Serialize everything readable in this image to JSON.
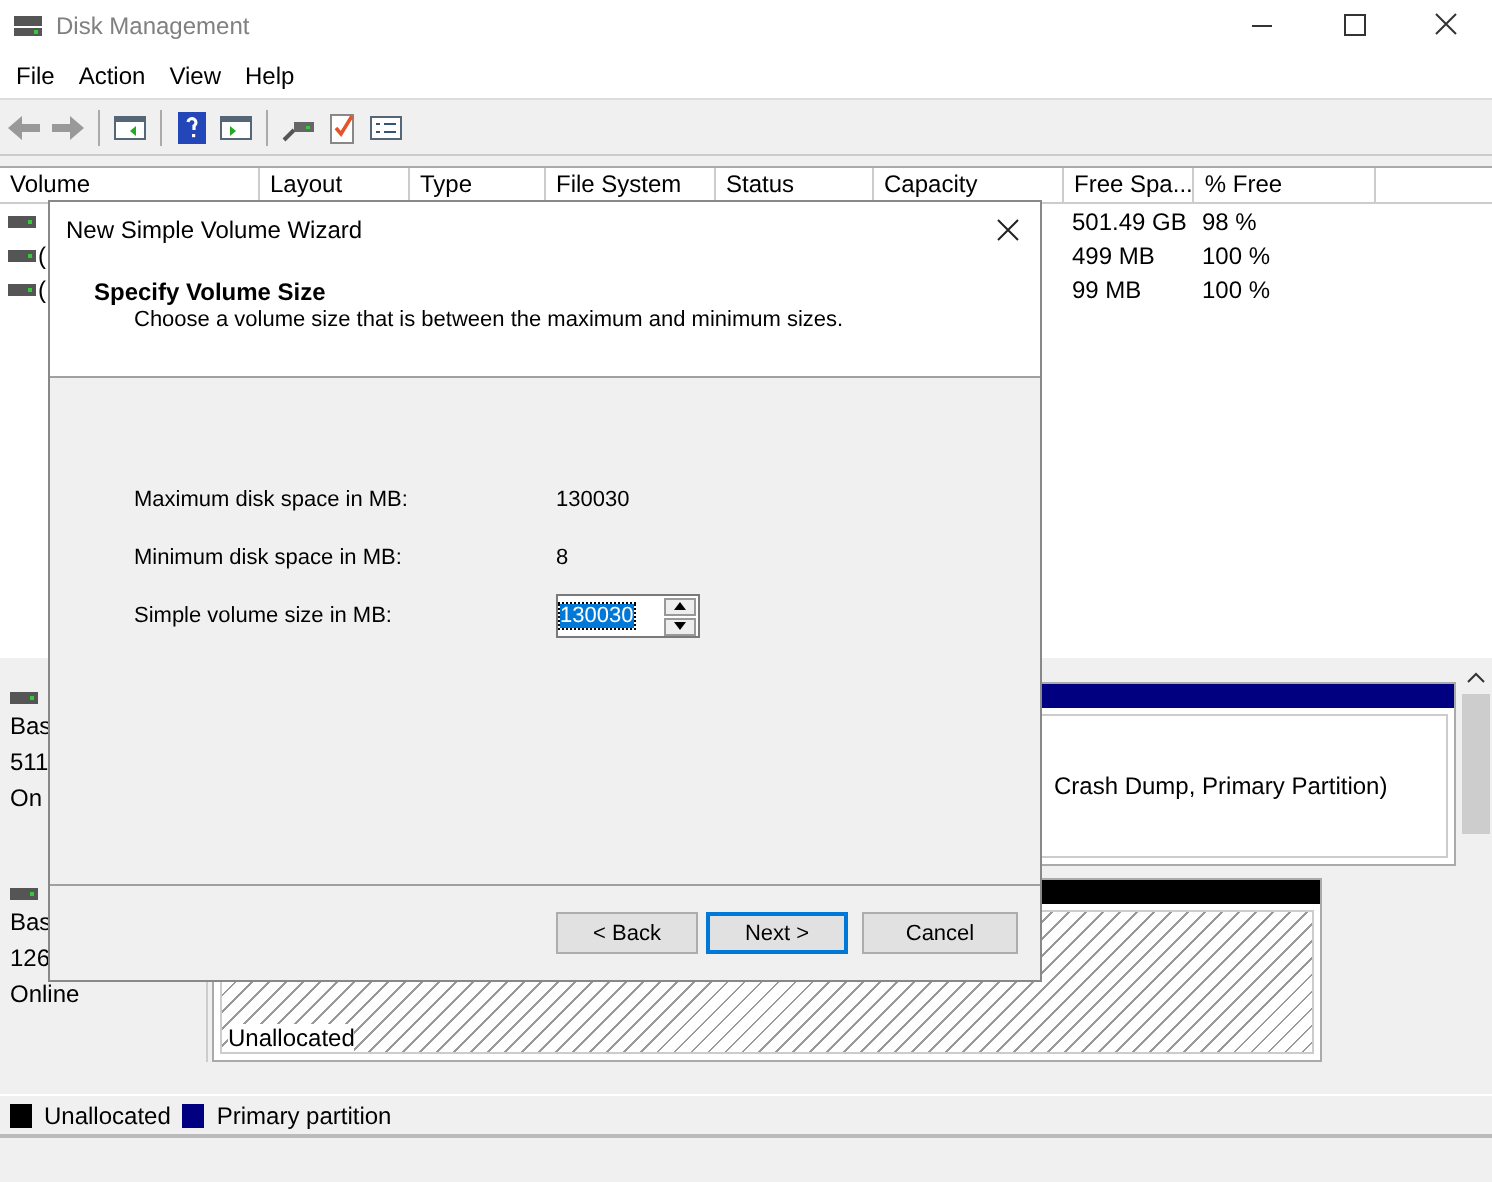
{
  "window": {
    "title": "Disk Management"
  },
  "menu": [
    "File",
    "Action",
    "View",
    "Help"
  ],
  "table": {
    "columns": [
      "Volume",
      "Layout",
      "Type",
      "File System",
      "Status",
      "Capacity",
      "Free Spa...",
      "% Free"
    ],
    "rows": [
      {
        "free_space": "501.49 GB",
        "percent_free": "98 %"
      },
      {
        "volume": "(",
        "free_space": "499 MB",
        "percent_free": "100 %"
      },
      {
        "volume": "(",
        "free_space": "99 MB",
        "percent_free": "100 %"
      }
    ]
  },
  "disks": [
    {
      "lines": [
        "Bas",
        "511",
        "On"
      ],
      "partition": {
        "kind": "primary",
        "text": "Crash Dump, Primary Partition)"
      }
    },
    {
      "lines": [
        "Bas",
        "126",
        "Online"
      ],
      "partition": {
        "kind": "unallocated",
        "text": "Unallocated"
      }
    }
  ],
  "legend": [
    {
      "label": "Unallocated",
      "color": "#000000"
    },
    {
      "label": "Primary partition",
      "color": "#000080"
    }
  ],
  "dialog": {
    "title": "New Simple Volume Wizard",
    "heading": "Specify Volume Size",
    "subtitle": "Choose a volume size that is between the maximum and minimum sizes.",
    "fields": [
      {
        "kind": "readout",
        "label": "Maximum disk space in MB:",
        "value": "130030"
      },
      {
        "kind": "readout",
        "label": "Minimum disk space in MB:",
        "value": "8"
      },
      {
        "kind": "spin",
        "label": "Simple volume size in MB:",
        "value": "130030",
        "text_selected": true
      }
    ],
    "buttons": [
      {
        "label": "< Back",
        "default": false
      },
      {
        "label": "Next >",
        "default": true
      },
      {
        "label": "Cancel",
        "default": false
      }
    ]
  }
}
